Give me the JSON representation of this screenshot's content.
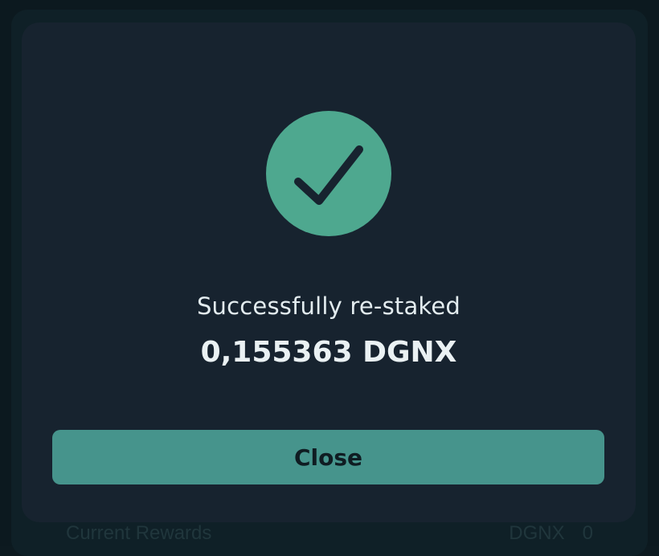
{
  "background": {
    "row_label": "Current Rewards",
    "row_currency": "DGNX",
    "row_value": "0"
  },
  "modal": {
    "icon": "check-icon",
    "message": "Successfully re-staked",
    "amount": "0,155363 DGNX",
    "close_label": "Close"
  },
  "colors": {
    "success_green": "#4ea88f",
    "button_teal": "#46948c",
    "modal_bg": "#17232f"
  }
}
